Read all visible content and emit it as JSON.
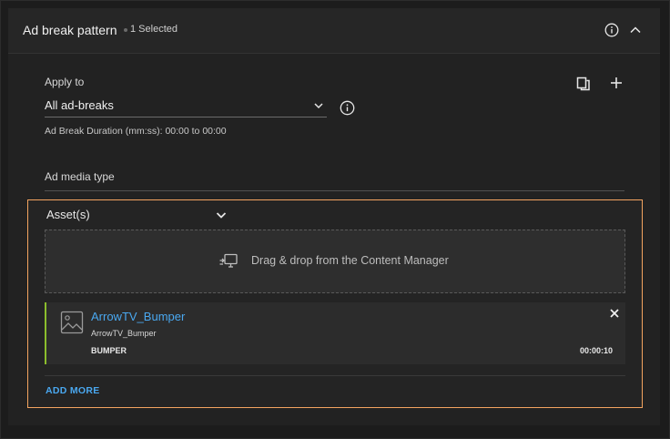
{
  "header": {
    "title": "Ad break pattern",
    "selected": "1 Selected"
  },
  "apply": {
    "label": "Apply to",
    "value": "All ad-breaks",
    "duration": "Ad Break Duration (mm:ss): 00:00 to 00:00"
  },
  "media": {
    "label": "Ad media type",
    "value": "Asset(s)"
  },
  "dropzone": {
    "text": "Drag & drop from the Content Manager"
  },
  "asset": {
    "name": "ArrowTV_Bumper",
    "subname": "ArrowTV_Bumper",
    "type": "BUMPER",
    "duration": "00:00:10"
  },
  "actions": {
    "add_more": "ADD MORE"
  },
  "colors": {
    "accent": "#4aa8f0",
    "highlight_border": "#f4a460",
    "card_stripe": "#8bbd2c"
  },
  "icons": {
    "header_info": "info-icon",
    "collapse": "chevron-up-icon",
    "copy": "copy-icon",
    "add": "plus-icon",
    "dropdown": "chevron-down-icon",
    "drag_drop": "drag-drop-icon",
    "thumbnail": "image-placeholder-icon",
    "remove": "close-icon"
  }
}
